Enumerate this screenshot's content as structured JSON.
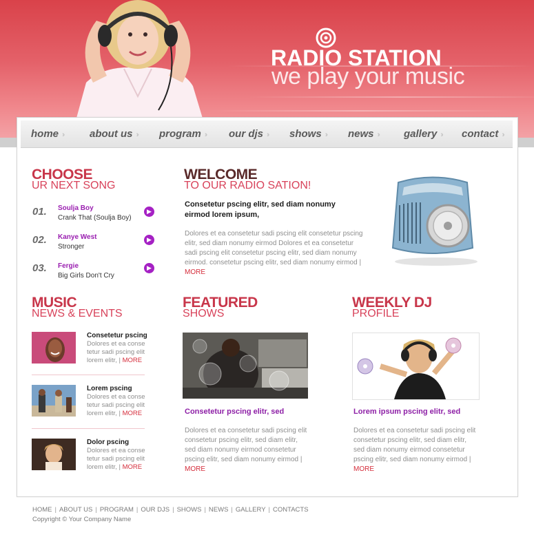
{
  "brand": {
    "name": "RADIO STATION",
    "tagline": "we play your music"
  },
  "nav": [
    {
      "label": "home"
    },
    {
      "label": "about us"
    },
    {
      "label": "program"
    },
    {
      "label": "our djs"
    },
    {
      "label": "shows"
    },
    {
      "label": "news"
    },
    {
      "label": "gallery"
    },
    {
      "label": "contact"
    }
  ],
  "choose": {
    "title": "CHOOSE",
    "subtitle": "UR NEXT SONG",
    "songs": [
      {
        "num": "01.",
        "artist": "Soulja Boy",
        "title": "Crank That (Soulja Boy)"
      },
      {
        "num": "02.",
        "artist": "Kanye West",
        "title": "Stronger"
      },
      {
        "num": "03.",
        "artist": "Fergie",
        "title": "Big Girls Don't Cry"
      }
    ]
  },
  "welcome": {
    "title": "WELCOME",
    "subtitle": "TO OUR RADIO SATION!",
    "lead": "Consetetur pscing elitr, sed diam nonumy eirmod lorem ipsum,",
    "body": "Dolores et ea consetetur sadi pscing elit consetetur pscing elitr, sed diam nonumy eirmod Dolores et ea consetetur sadi pscing elit consetetur pscing elitr, sed diam nonumy eirmod. consetetur pscing elitr, sed diam nonumy eirmod",
    "more": "MORE"
  },
  "music_news": {
    "title": "MUSIC",
    "subtitle": "NEWS & EVENTS",
    "items": [
      {
        "title": "Consetetur pscing",
        "text": "Dolores et ea conse tetur sadi pscing elit lorem elitr,",
        "more": "MORE"
      },
      {
        "title": "Lorem pscing",
        "text": "Dolores et ea conse tetur sadi pscing elit lorem elitr,",
        "more": "MORE"
      },
      {
        "title": "Dolor pscing",
        "text": "Dolores et ea conse tetur sadi pscing elit lorem elitr,",
        "more": "MORE"
      }
    ]
  },
  "featured": {
    "title": "FEATURED",
    "subtitle": "SHOWS",
    "link": "Consetetur pscing elitr, sed",
    "body": "Dolores et ea consetetur sadi pscing elit consetetur pscing elitr, sed diam elitr, sed diam nonumy eirmod consetetur pscing elitr, sed diam nonumy eirmod",
    "more": "MORE"
  },
  "weekly_dj": {
    "title": "WEEKLY DJ",
    "subtitle": "PROFILE",
    "link": "Lorem ipsum pscing elitr, sed",
    "body": "Dolores et ea consetetur sadi pscing elit consetetur pscing elitr, sed diam elitr, sed diam nonumy eirmod consetetur pscing elitr, sed diam nonumy eirmod",
    "more": "MORE"
  },
  "footer": {
    "links": [
      "HOME",
      "ABOUT US",
      "PROGRAM",
      "OUR DJS",
      "SHOWS",
      "NEWS",
      "GALLERY",
      "CONTACTS"
    ],
    "copyright": "Copyright © Your Company Name"
  },
  "colors": {
    "header_red": "#d9424a",
    "accent_purple": "#9a1fb0",
    "more_red": "#d52d3b"
  }
}
